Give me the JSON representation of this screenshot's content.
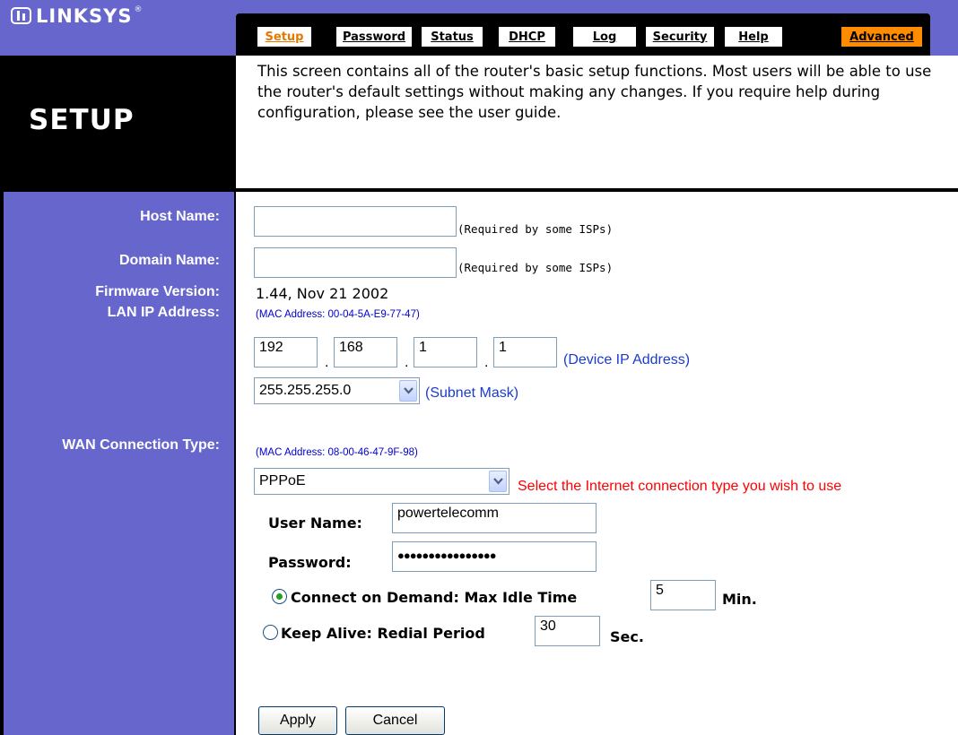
{
  "brand": {
    "logo_text": "LINKSYS",
    "logo_reg": "®"
  },
  "tabs": [
    {
      "label": "Setup",
      "active": true
    },
    {
      "label": "Password",
      "active": false
    },
    {
      "label": "Status",
      "active": false
    },
    {
      "label": "DHCP",
      "active": false
    },
    {
      "label": "Log",
      "active": false
    },
    {
      "label": "Security",
      "active": false
    },
    {
      "label": "Help",
      "active": false
    },
    {
      "label": "Advanced",
      "active": false
    }
  ],
  "page": {
    "title": "SETUP",
    "intro": "This screen contains all of the router's basic setup functions. Most users will be able to use the router's default settings without making any changes. If you require help during configuration, please see the user guide."
  },
  "labels": {
    "host_name": "Host Name:",
    "domain_name": "Domain Name:",
    "firmware_version": "Firmware Version:",
    "lan_ip": "LAN IP Address:",
    "wan_type": "WAN Connection Type:"
  },
  "form": {
    "host_name_value": "",
    "domain_name_value": "",
    "required_hint": "(Required by some ISPs)",
    "firmware": "1.44, Nov 21 2002",
    "lan_mac": "(MAC Address: 00-04-5A-E9-77-47)",
    "ip_octets": [
      "192",
      "168",
      "1",
      "1"
    ],
    "ip_dot": ".",
    "device_ip_note": "(Device IP Address)",
    "subnet_mask": "255.255.255.0",
    "subnet_note": "(Subnet Mask)",
    "wan_mac": "(MAC Address: 08-00-46-47-9F-98)",
    "wan_type": "PPPoE",
    "wan_note": "Select the Internet connection type you wish to use",
    "user_name_label": "User Name:",
    "user_name_value": "powertelecomm",
    "password_label": "Password:",
    "password_value": "●●●●●●●●●●●●●●●●",
    "connect_on_demand_label": "Connect on Demand: Max Idle Time",
    "max_idle_time": "5",
    "min_label": "Min.",
    "keep_alive_label": "Keep Alive: Redial Period",
    "redial_period": "30",
    "sec_label": "Sec.",
    "connect_on_demand_selected": true
  },
  "buttons": {
    "apply": "Apply",
    "cancel": "Cancel"
  },
  "colors": {
    "panel": "#6666cc",
    "active_tab": "#e67800",
    "advanced_tab": "#ff8c00",
    "link_blue": "#1a3ccc",
    "warning_red": "#ff0000"
  }
}
